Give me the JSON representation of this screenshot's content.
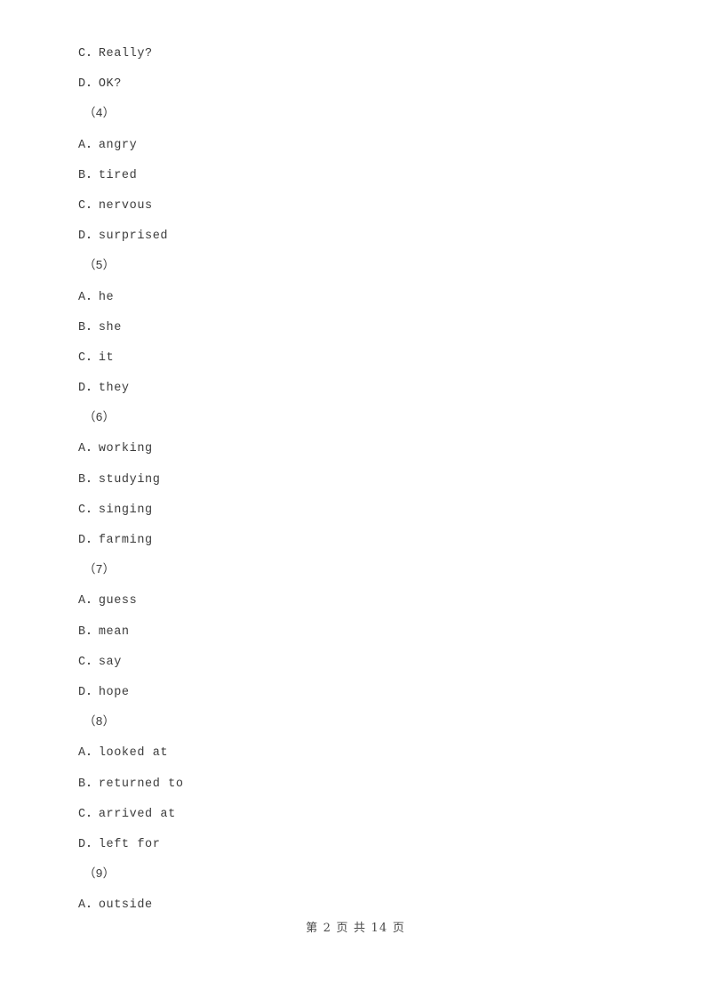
{
  "document": {
    "page_background": "#ffffff",
    "text_color": "#3c3c3c",
    "blocks": [
      {
        "kind": "option",
        "letter": "C",
        "separator": "．",
        "text": "Really?",
        "full": "C．Really?"
      },
      {
        "kind": "option",
        "letter": "D",
        "separator": "．",
        "text": "OK?",
        "full": "D．OK?"
      },
      {
        "kind": "group",
        "number": "4",
        "full": "（4）"
      },
      {
        "kind": "option",
        "letter": "A",
        "separator": "．",
        "text": "angry",
        "full": "A．angry"
      },
      {
        "kind": "option",
        "letter": "B",
        "separator": "．",
        "text": "tired",
        "full": "B．tired"
      },
      {
        "kind": "option",
        "letter": "C",
        "separator": "．",
        "text": "nervous",
        "full": "C．nervous"
      },
      {
        "kind": "option",
        "letter": "D",
        "separator": "．",
        "text": "surprised",
        "full": "D．surprised"
      },
      {
        "kind": "group",
        "number": "5",
        "full": "（5）"
      },
      {
        "kind": "option",
        "letter": "A",
        "separator": "．",
        "text": "he",
        "full": "A．he"
      },
      {
        "kind": "option",
        "letter": "B",
        "separator": "．",
        "text": "she",
        "full": "B．she"
      },
      {
        "kind": "option",
        "letter": "C",
        "separator": "．",
        "text": "it",
        "full": "C．it"
      },
      {
        "kind": "option",
        "letter": "D",
        "separator": "．",
        "text": "they",
        "full": "D．they"
      },
      {
        "kind": "group",
        "number": "6",
        "full": "（6）"
      },
      {
        "kind": "option",
        "letter": "A",
        "separator": "．",
        "text": "working",
        "full": "A．working"
      },
      {
        "kind": "option",
        "letter": "B",
        "separator": "．",
        "text": "studying",
        "full": "B．studying"
      },
      {
        "kind": "option",
        "letter": "C",
        "separator": "．",
        "text": "singing",
        "full": "C．singing"
      },
      {
        "kind": "option",
        "letter": "D",
        "separator": "．",
        "text": "farming",
        "full": "D．farming"
      },
      {
        "kind": "group",
        "number": "7",
        "full": "（7）"
      },
      {
        "kind": "option",
        "letter": "A",
        "separator": "．",
        "text": "guess",
        "full": "A．guess"
      },
      {
        "kind": "option",
        "letter": "B",
        "separator": "．",
        "text": "mean",
        "full": "B．mean"
      },
      {
        "kind": "option",
        "letter": "C",
        "separator": "．",
        "text": "say",
        "full": "C．say"
      },
      {
        "kind": "option",
        "letter": "D",
        "separator": "．",
        "text": "hope",
        "full": "D．hope"
      },
      {
        "kind": "group",
        "number": "8",
        "full": "（8）"
      },
      {
        "kind": "option",
        "letter": "A",
        "separator": "．",
        "text": "looked at",
        "full": "A．looked at"
      },
      {
        "kind": "option",
        "letter": "B",
        "separator": "．",
        "text": "returned to",
        "full": "B．returned to"
      },
      {
        "kind": "option",
        "letter": "C",
        "separator": "．",
        "text": "arrived at",
        "full": "C．arrived at"
      },
      {
        "kind": "option",
        "letter": "D",
        "separator": "．",
        "text": "left for",
        "full": "D．left for"
      },
      {
        "kind": "group",
        "number": "9",
        "full": "（9）"
      },
      {
        "kind": "option",
        "letter": "A",
        "separator": "．",
        "text": "outside",
        "full": "A．outside"
      }
    ]
  },
  "footer": {
    "text": "第 2 页 共 14 页",
    "current_page": "2",
    "total_pages": "14"
  }
}
